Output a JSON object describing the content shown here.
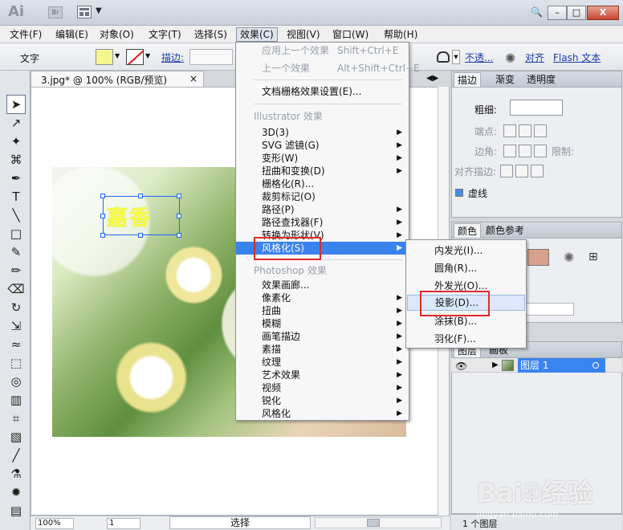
{
  "window": {
    "app_logo": "Ai",
    "bridge": "Br",
    "title_search": "🔍",
    "minimize": "–",
    "maximize": "□",
    "close": "X"
  },
  "menus": {
    "file": "文件(F)",
    "edit": "编辑(E)",
    "object": "对象(O)",
    "type": "文字(T)",
    "select": "选择(S)",
    "effect": "效果(C)",
    "view": "视图(V)",
    "window": "窗口(W)",
    "help": "帮助(H)"
  },
  "controlbar": {
    "context_label": "文字",
    "stroke_label": "描边:",
    "opacity_label": "不透...",
    "align_label": "对齐",
    "flash_label": "Flash 文本"
  },
  "document": {
    "tab_title": "3.jpg* @ 100% (RGB/预览)",
    "tab_close": "×",
    "selected_text": "嘉香"
  },
  "effect_menu": {
    "apply_last": "应用上一个效果",
    "apply_last_shortcut": "Shift+Ctrl+E",
    "last_effect": "上一个效果",
    "last_effect_shortcut": "Alt+Shift+Ctrl+E",
    "raster_settings": "文档栅格效果设置(E)...",
    "illustrator_section": "Illustrator 效果",
    "items": {
      "3d": "3D(3)",
      "svg": "SVG 滤镜(G)",
      "distort": "变形(W)",
      "transform": "扭曲和变换(D)",
      "rasterize": "栅格化(R)...",
      "crop_marks": "裁剪标记(O)",
      "path": "路径(P)",
      "pathfinder": "路径查找器(F)",
      "convert_shape": "转换为形状(V)",
      "stylize": "风格化(S)"
    },
    "photoshop_section": "Photoshop 效果",
    "ps_items": {
      "gallery": "效果画廊...",
      "pixelate": "像素化",
      "distort": "扭曲",
      "blur": "模糊",
      "brush": "画笔描边",
      "sketch": "素描",
      "texture": "纹理",
      "artistic": "艺术效果",
      "video": "视频",
      "sharpen": "锐化",
      "stylize": "风格化"
    }
  },
  "stylize_submenu": {
    "inner_glow": "内发光(I)...",
    "round_corners": "圆角(R)...",
    "outer_glow": "外发光(O)...",
    "drop_shadow": "投影(D)...",
    "scribble": "涂抹(B)...",
    "feather": "羽化(F)..."
  },
  "stroke_panel": {
    "tab_stroke": "描边",
    "tab_gradient": "渐变",
    "tab_transparency": "透明度",
    "weight": "粗细:",
    "cap": "端点:",
    "corner": "边角:",
    "limit": "限制:",
    "align": "对齐描边:",
    "dashed": "虚线"
  },
  "color_panel": {
    "tab_color": "颜色",
    "tab_guide": "颜色参考"
  },
  "layers_panel": {
    "tab_layers": "图层",
    "tab_artboards": "画板",
    "layer_name": "图层 1",
    "footer_count": "1 个图层"
  },
  "status": {
    "zoom": "100%",
    "page": "1",
    "status_text": "选择"
  },
  "watermark": {
    "main": "Baiඹ经验",
    "sub": "jingyan.baidu.com"
  }
}
